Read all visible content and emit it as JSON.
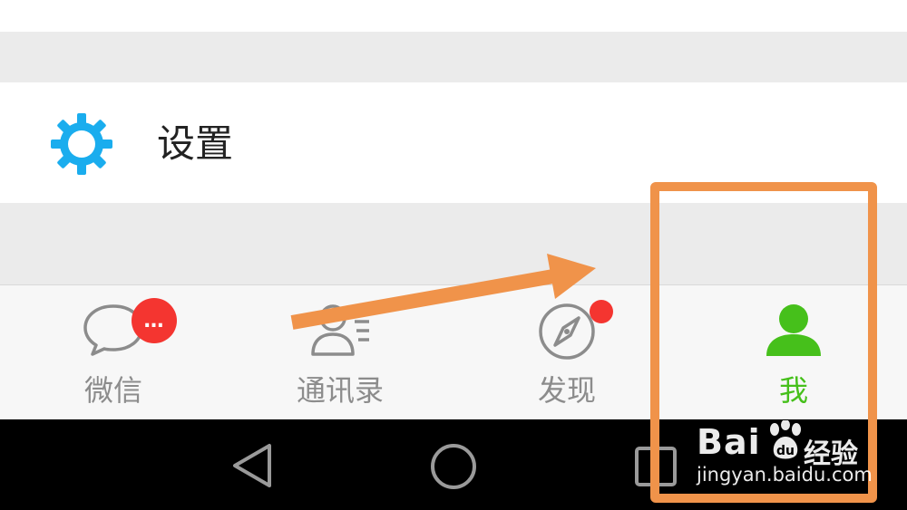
{
  "settings": {
    "label": "设置",
    "icon": "gear-icon",
    "icon_color": "#1aadee"
  },
  "tabs": [
    {
      "label": "微信",
      "icon": "chat-bubble-icon",
      "badge": "…",
      "active": false
    },
    {
      "label": "通讯录",
      "icon": "contacts-icon",
      "active": false
    },
    {
      "label": "发现",
      "icon": "compass-icon",
      "badge_dot": true,
      "active": false
    },
    {
      "label": "我",
      "icon": "person-icon",
      "active": true
    }
  ],
  "colors": {
    "active_tab": "#46c01b",
    "inactive_tab": "#8c8c8c",
    "badge": "#f43530",
    "annotation": "#f0934a"
  },
  "nav": {
    "back_icon": "triangle-back-icon",
    "home_icon": "circle-home-icon",
    "recent_icon": "square-recent-icon"
  },
  "watermark": {
    "logo": "Bai",
    "logo_suffix": "经验",
    "url": "jingyan.baidu.com"
  }
}
